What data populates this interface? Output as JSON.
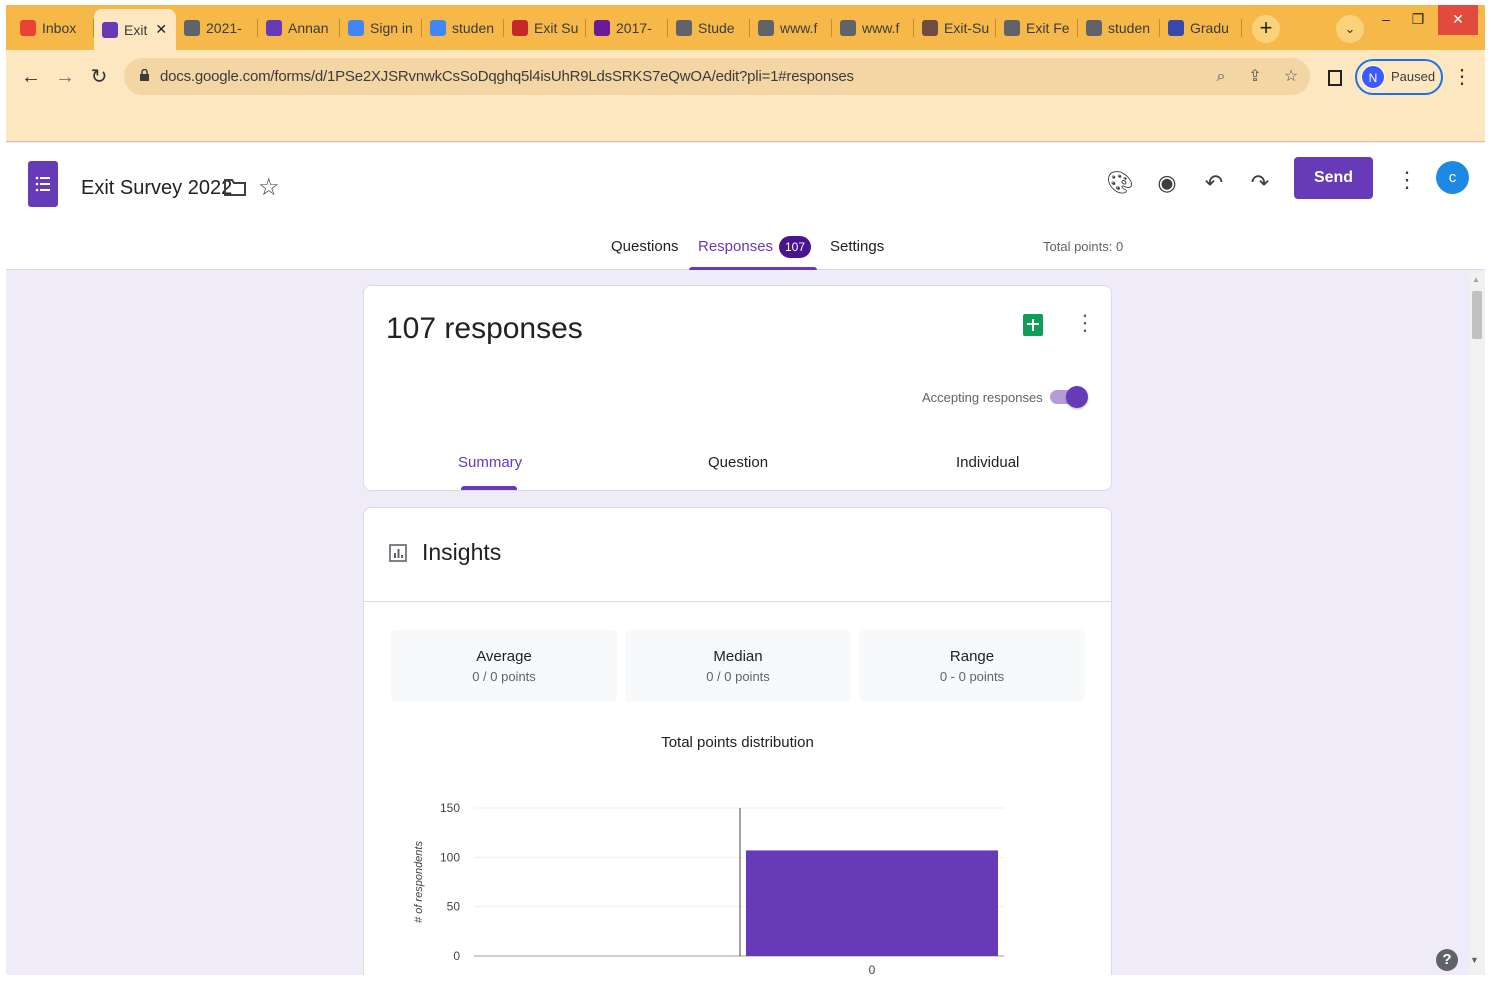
{
  "browser": {
    "tabs": [
      {
        "label": "Inbox",
        "icon": "gmail-icon",
        "color": "#ea4335"
      },
      {
        "label": "Exit",
        "icon": "forms-icon",
        "color": "#673ab7",
        "active": true
      },
      {
        "label": "2021-",
        "icon": "globe-icon",
        "color": "#5f6368"
      },
      {
        "label": "Annan",
        "icon": "forms-icon",
        "color": "#673ab7"
      },
      {
        "label": "Sign in",
        "icon": "google-icon",
        "color": "#4285f4"
      },
      {
        "label": "studen",
        "icon": "google-icon",
        "color": "#4285f4"
      },
      {
        "label": "Exit Su",
        "icon": "site-icon",
        "color": "#c62828"
      },
      {
        "label": "2017-",
        "icon": "site-icon",
        "color": "#6a1b9a"
      },
      {
        "label": "Stude",
        "icon": "globe-icon",
        "color": "#5f6368"
      },
      {
        "label": "www.f",
        "icon": "globe-icon",
        "color": "#5f6368"
      },
      {
        "label": "www.f",
        "icon": "globe-icon",
        "color": "#5f6368"
      },
      {
        "label": "Exit-Su",
        "icon": "site-icon",
        "color": "#6d4c41"
      },
      {
        "label": "Exit Fe",
        "icon": "download-icon",
        "color": "#5f6368"
      },
      {
        "label": "studen",
        "icon": "download-icon",
        "color": "#5f6368"
      },
      {
        "label": "Gradu",
        "icon": "site-icon",
        "color": "#3949ab"
      }
    ],
    "new_tab": "+",
    "url": "docs.google.com/forms/d/1PSe2XJSRvnwkCsSoDqghq5l4isUhR9LdsSRKS7eQwOA/edit?pli=1#responses",
    "profile_initial": "N",
    "profile_status": "Paused"
  },
  "forms": {
    "title": "Exit Survey 2022",
    "send_label": "Send",
    "user_initial": "c",
    "tabs": {
      "questions": "Questions",
      "responses": "Responses",
      "settings": "Settings"
    },
    "responses_badge": "107",
    "total_points": "Total points: 0"
  },
  "responses_card": {
    "title": "107 responses",
    "accepting_label": "Accepting responses",
    "accepting": true,
    "subtabs": {
      "summary": "Summary",
      "question": "Question",
      "individual": "Individual"
    }
  },
  "insights": {
    "title": "Insights",
    "stats": [
      {
        "label": "Average",
        "value": "0 / 0 points"
      },
      {
        "label": "Median",
        "value": "0 / 0 points"
      },
      {
        "label": "Range",
        "value": "0 - 0 points"
      }
    ],
    "chart_title": "Total points distribution"
  },
  "chart_data": {
    "type": "bar",
    "title": "Total points distribution",
    "xlabel": "",
    "ylabel": "# of respondents",
    "categories": [
      "0"
    ],
    "values": [
      107
    ],
    "ylim": [
      0,
      150
    ],
    "yticks": [
      0,
      50,
      100,
      150
    ],
    "grid": true,
    "color": "#673ab7"
  }
}
